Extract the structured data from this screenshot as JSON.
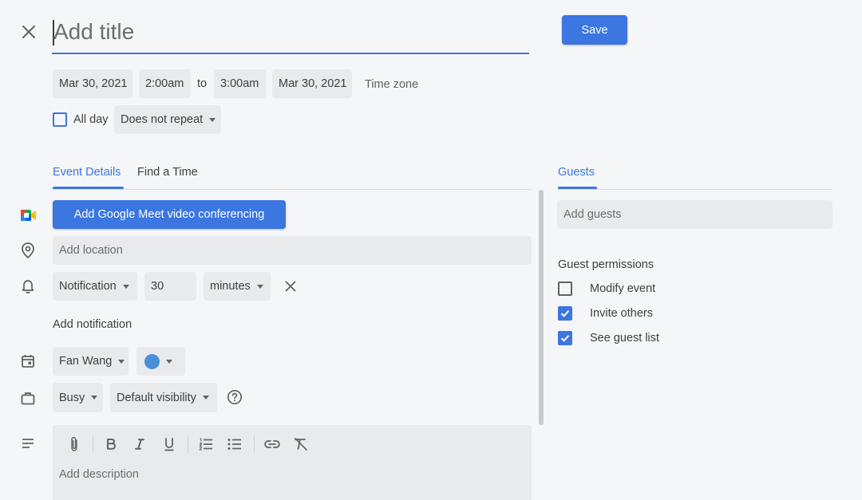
{
  "title": {
    "placeholder": "Add title"
  },
  "save_label": "Save",
  "dates": {
    "start_date": "Mar 30, 2021",
    "start_time": "2:00am",
    "to": "to",
    "end_time": "3:00am",
    "end_date": "Mar 30, 2021",
    "timezone": "Time zone"
  },
  "all_day_label": "All day",
  "repeat_label": "Does not repeat",
  "tabs": {
    "details": "Event Details",
    "find_time": "Find a Time",
    "guests": "Guests"
  },
  "meet_label": "Add Google Meet video conferencing",
  "location_placeholder": "Add location",
  "notification": {
    "type": "Notification",
    "value": "30",
    "unit": "minutes"
  },
  "add_notification": "Add notification",
  "calendar_owner": "Fan Wang",
  "busy_label": "Busy",
  "visibility_label": "Default visibility",
  "description_placeholder": "Add description",
  "guests": {
    "add_placeholder": "Add guests",
    "permissions_title": "Guest permissions",
    "modify": "Modify event",
    "invite": "Invite others",
    "see_list": "See guest list"
  },
  "colors": {
    "accent": "#3b76e1",
    "event_color": "#4a90d9"
  },
  "checkbox_states": {
    "all_day": false,
    "modify_event": false,
    "invite_others": true,
    "see_guest_list": true
  }
}
